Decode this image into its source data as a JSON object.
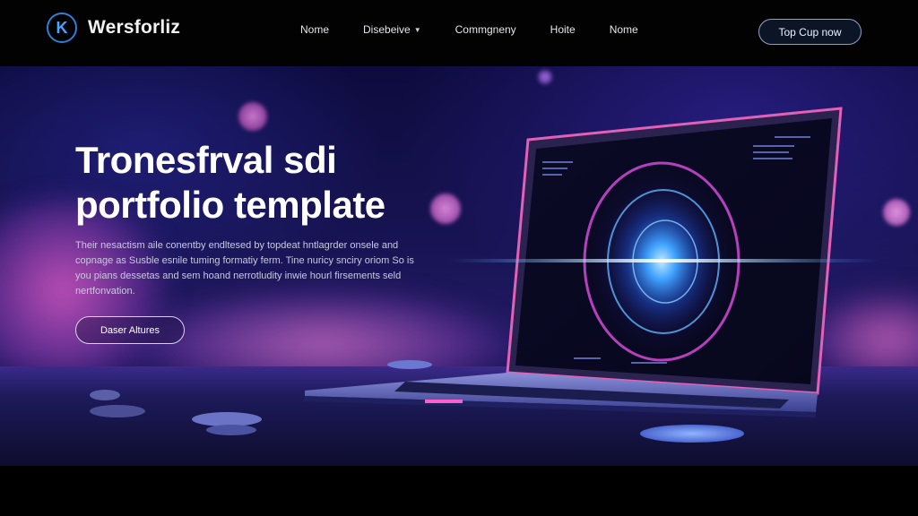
{
  "brand": {
    "name": "Wersforliz",
    "logo_icon": "k-monogram-icon"
  },
  "nav": {
    "items": [
      {
        "label": "Nome",
        "has_dropdown": false
      },
      {
        "label": "Disebeive",
        "has_dropdown": true
      },
      {
        "label": "Commgneny",
        "has_dropdown": false
      },
      {
        "label": "Hoite",
        "has_dropdown": false
      },
      {
        "label": "Nome",
        "has_dropdown": false
      }
    ],
    "cta_label": "Top Cup now"
  },
  "hero": {
    "title_line1": "Tronesfrval sdi",
    "title_line2": "portfolio template",
    "description": "Their nesactism aile conentby endltesed by topdeat hntlagrder onsele and copnage as Susble esnile tuming formatiy ferm. Tine nuricy snciry oriom So is you pians dessetas and sem hoand nerrotludity inwie hourl firsements seld nertfonvation.",
    "button_label": "Daser Altures"
  },
  "colors": {
    "accent": "#2f7fd6",
    "hero_bg": "#181454",
    "glow_magenta": "#d24ad8",
    "glow_blue": "#3fa2ff"
  }
}
